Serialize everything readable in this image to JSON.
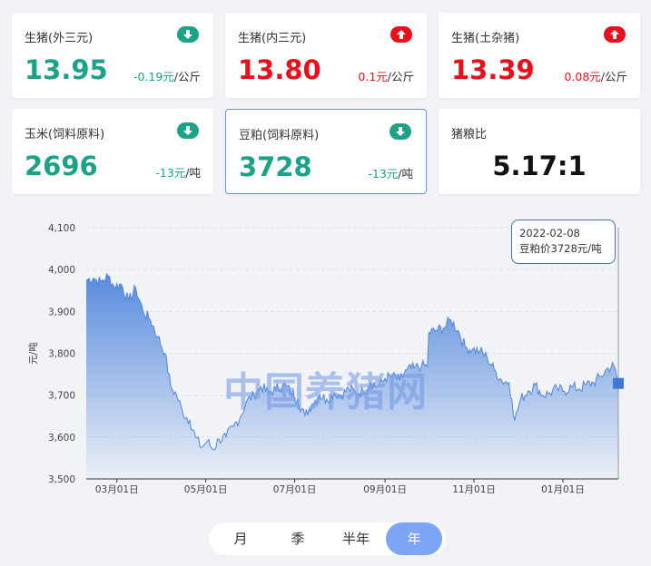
{
  "cards": [
    {
      "label": "生猪(外三元)",
      "value": "13.95",
      "change": "-0.19元",
      "unit": "/公斤",
      "trend": "down"
    },
    {
      "label": "生猪(内三元)",
      "value": "13.80",
      "change": "0.1元",
      "unit": "/公斤",
      "trend": "up"
    },
    {
      "label": "生猪(土杂猪)",
      "value": "13.39",
      "change": "0.08元",
      "unit": "/公斤",
      "trend": "up"
    },
    {
      "label": "玉米(饲料原料)",
      "value": "2696",
      "change": "-13元",
      "unit": "/吨",
      "trend": "down"
    },
    {
      "label": "豆粕(饲料原料)",
      "value": "3728",
      "change": "-13元",
      "unit": "/吨",
      "trend": "down"
    }
  ],
  "ratio": {
    "label": "猪粮比",
    "value": "5.17:1"
  },
  "colors": {
    "green": "#1ca387",
    "red": "#e8101a",
    "line": "#4f86dc",
    "accent": "#7ea4f5"
  },
  "watermark": "中国养猪网",
  "tooltip": {
    "date": "2022-02-08",
    "text": "豆粕价3728元/吨"
  },
  "periods": {
    "month": "月",
    "quarter": "季",
    "half": "半年",
    "year": "年",
    "active": "year"
  },
  "chart_data": {
    "type": "area",
    "ylabel": "元/吨",
    "ylim": [
      3500,
      4100
    ],
    "yticks": [
      3500,
      3600,
      3700,
      3800,
      3900,
      4000,
      4100
    ],
    "ytick_labels": [
      "3,500",
      "3,600",
      "3,700",
      "3,800",
      "3,900",
      "4,000",
      "4,100"
    ],
    "xlim": [
      "2021-02-08",
      "2022-02-08"
    ],
    "xtick_dates": [
      "2021-03-01",
      "2021-05-01",
      "2021-07-01",
      "2021-09-01",
      "2021-11-01",
      "2022-01-01"
    ],
    "xtick_labels": [
      "03月01日",
      "05月01日",
      "07月01日",
      "09月01日",
      "11月01日",
      "01月01日"
    ],
    "grid": true,
    "series": [
      {
        "points": [
          [
            "2021-02-08",
            3975
          ],
          [
            "2021-02-13",
            3980
          ],
          [
            "2021-02-18",
            3970
          ],
          [
            "2021-02-23",
            3985
          ],
          [
            "2021-02-27",
            3960
          ],
          [
            "2021-03-04",
            3965
          ],
          [
            "2021-03-09",
            3925
          ],
          [
            "2021-03-14",
            3955
          ],
          [
            "2021-03-19",
            3900
          ],
          [
            "2021-03-24",
            3880
          ],
          [
            "2021-03-29",
            3840
          ],
          [
            "2021-04-03",
            3800
          ],
          [
            "2021-04-07",
            3720
          ],
          [
            "2021-04-11",
            3700
          ],
          [
            "2021-04-15",
            3660
          ],
          [
            "2021-04-20",
            3640
          ],
          [
            "2021-04-24",
            3600
          ],
          [
            "2021-04-28",
            3575
          ],
          [
            "2021-05-02",
            3590
          ],
          [
            "2021-05-06",
            3570
          ],
          [
            "2021-05-10",
            3595
          ],
          [
            "2021-05-15",
            3600
          ],
          [
            "2021-05-20",
            3625
          ],
          [
            "2021-05-25",
            3650
          ],
          [
            "2021-05-29",
            3685
          ],
          [
            "2021-06-03",
            3700
          ],
          [
            "2021-06-08",
            3720
          ],
          [
            "2021-06-13",
            3705
          ],
          [
            "2021-06-18",
            3715
          ],
          [
            "2021-06-23",
            3725
          ],
          [
            "2021-06-28",
            3710
          ],
          [
            "2021-07-03",
            3690
          ],
          [
            "2021-07-08",
            3650
          ],
          [
            "2021-07-13",
            3680
          ],
          [
            "2021-07-18",
            3700
          ],
          [
            "2021-07-23",
            3690
          ],
          [
            "2021-07-28",
            3705
          ],
          [
            "2021-08-02",
            3700
          ],
          [
            "2021-08-07",
            3715
          ],
          [
            "2021-08-12",
            3705
          ],
          [
            "2021-08-17",
            3710
          ],
          [
            "2021-08-22",
            3730
          ],
          [
            "2021-08-27",
            3720
          ],
          [
            "2021-09-01",
            3740
          ],
          [
            "2021-09-06",
            3745
          ],
          [
            "2021-09-11",
            3735
          ],
          [
            "2021-09-16",
            3760
          ],
          [
            "2021-09-21",
            3765
          ],
          [
            "2021-09-26",
            3770
          ],
          [
            "2021-09-30",
            3768
          ],
          [
            "2021-10-01",
            3850
          ],
          [
            "2021-10-06",
            3855
          ],
          [
            "2021-10-11",
            3860
          ],
          [
            "2021-10-16",
            3880
          ],
          [
            "2021-10-21",
            3855
          ],
          [
            "2021-10-26",
            3815
          ],
          [
            "2021-10-31",
            3810
          ],
          [
            "2021-11-05",
            3805
          ],
          [
            "2021-11-10",
            3790
          ],
          [
            "2021-11-15",
            3760
          ],
          [
            "2021-11-20",
            3735
          ],
          [
            "2021-11-25",
            3730
          ],
          [
            "2021-11-27",
            3690
          ],
          [
            "2021-11-29",
            3640
          ],
          [
            "2021-12-03",
            3690
          ],
          [
            "2021-12-08",
            3710
          ],
          [
            "2021-12-13",
            3725
          ],
          [
            "2021-12-18",
            3700
          ],
          [
            "2021-12-23",
            3705
          ],
          [
            "2021-12-28",
            3715
          ],
          [
            "2022-01-02",
            3710
          ],
          [
            "2022-01-07",
            3720
          ],
          [
            "2022-01-12",
            3715
          ],
          [
            "2022-01-17",
            3725
          ],
          [
            "2022-01-22",
            3730
          ],
          [
            "2022-01-27",
            3745
          ],
          [
            "2022-02-01",
            3765
          ],
          [
            "2022-02-05",
            3770
          ],
          [
            "2022-02-08",
            3728
          ]
        ]
      }
    ]
  }
}
